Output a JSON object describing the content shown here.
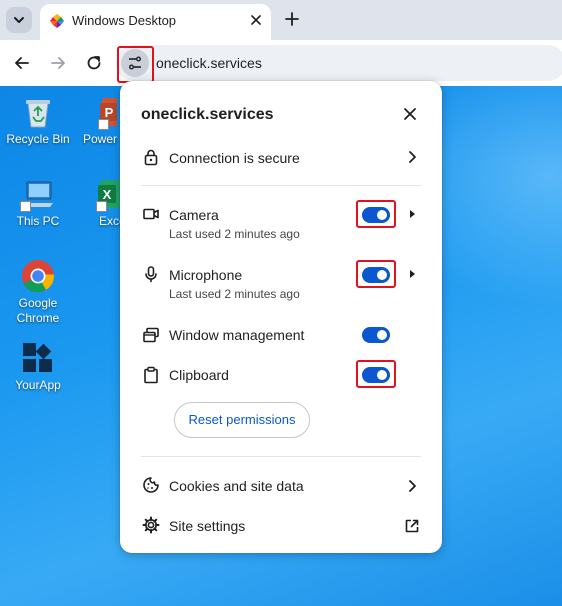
{
  "browser": {
    "tab_title": "Windows Desktop",
    "url": "oneclick.services"
  },
  "desktop": {
    "icons": [
      {
        "label": "Recycle Bin",
        "icon": "recycle-bin-icon"
      },
      {
        "label": "PowerP",
        "icon": "powerpoint-icon"
      },
      {
        "label": "This PC",
        "icon": "this-pc-icon"
      },
      {
        "label": "Exce",
        "icon": "excel-icon"
      },
      {
        "label": "Google Chrome",
        "line1": "Google",
        "line2": "Chrome",
        "icon": "chrome-icon"
      },
      {
        "label": "YourApp",
        "icon": "yourapp-icon"
      }
    ]
  },
  "popup": {
    "title": "oneclick.services",
    "connection": "Connection is secure",
    "permissions": [
      {
        "label": "Camera",
        "sub": "Last used 2 minutes ago",
        "enabled": true,
        "highlighted": true
      },
      {
        "label": "Microphone",
        "sub": "Last used 2 minutes ago",
        "enabled": true,
        "highlighted": true
      },
      {
        "label": "Window management",
        "sub": "",
        "enabled": true,
        "highlighted": false
      },
      {
        "label": "Clipboard",
        "sub": "",
        "enabled": true,
        "highlighted": true
      }
    ],
    "reset_label": "Reset permissions",
    "cookies_label": "Cookies and site data",
    "site_settings_label": "Site settings"
  },
  "colors": {
    "toggle_on": "#0b57d0",
    "highlight_box": "#e3101d",
    "desktop_blue": "#1a98f0"
  }
}
